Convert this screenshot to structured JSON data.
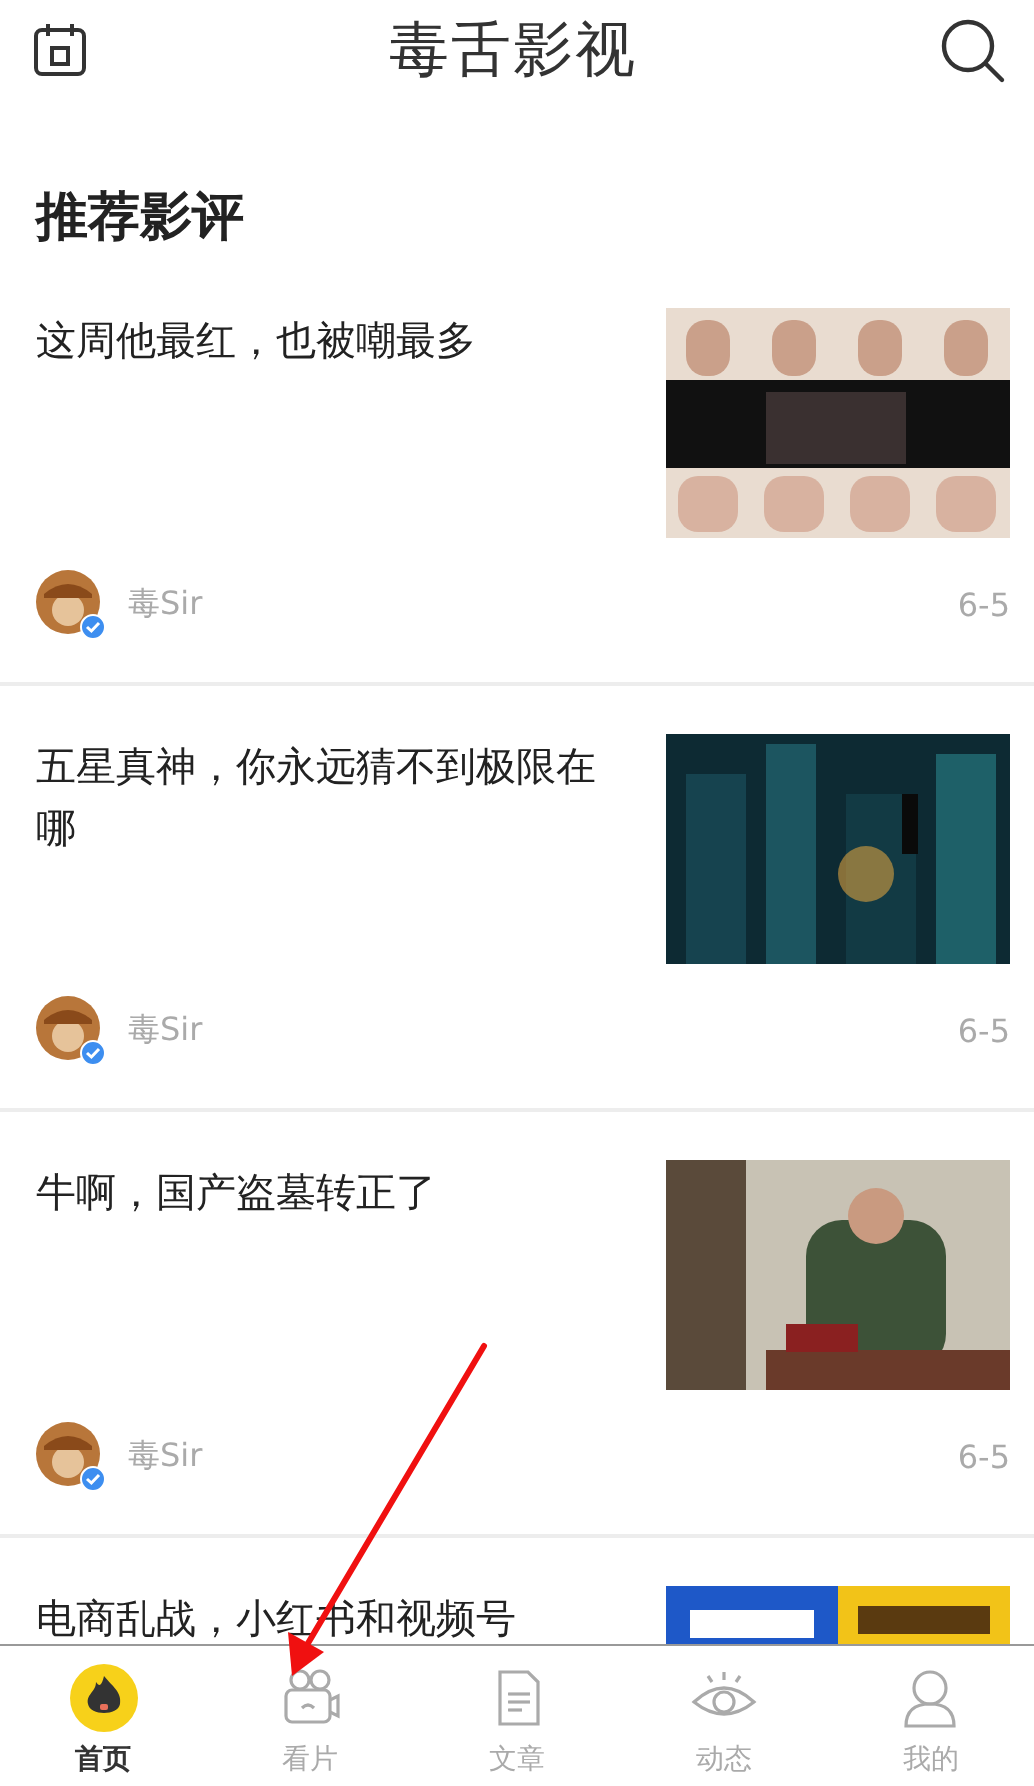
{
  "header": {
    "logo": "毒舌影视"
  },
  "section_title": "推荐影评",
  "articles": [
    {
      "title": "这周他最红，也被嘲最多",
      "author": "毒Sir",
      "date": "6-5"
    },
    {
      "title": "五星真神，你永远猜不到极限在哪",
      "author": "毒Sir",
      "date": "6-5"
    },
    {
      "title": "牛啊，国产盗墓转正了",
      "author": "毒Sir",
      "date": "6-5"
    },
    {
      "title": "电商乱战，小红书和视频号"
    }
  ],
  "tabs": [
    {
      "label": "首页",
      "kind": "home",
      "selected": true
    },
    {
      "label": "看片",
      "kind": "watch",
      "selected": false
    },
    {
      "label": "文章",
      "kind": "article",
      "selected": false
    },
    {
      "label": "动态",
      "kind": "feed",
      "selected": false
    },
    {
      "label": "我的",
      "kind": "me",
      "selected": false
    }
  ]
}
